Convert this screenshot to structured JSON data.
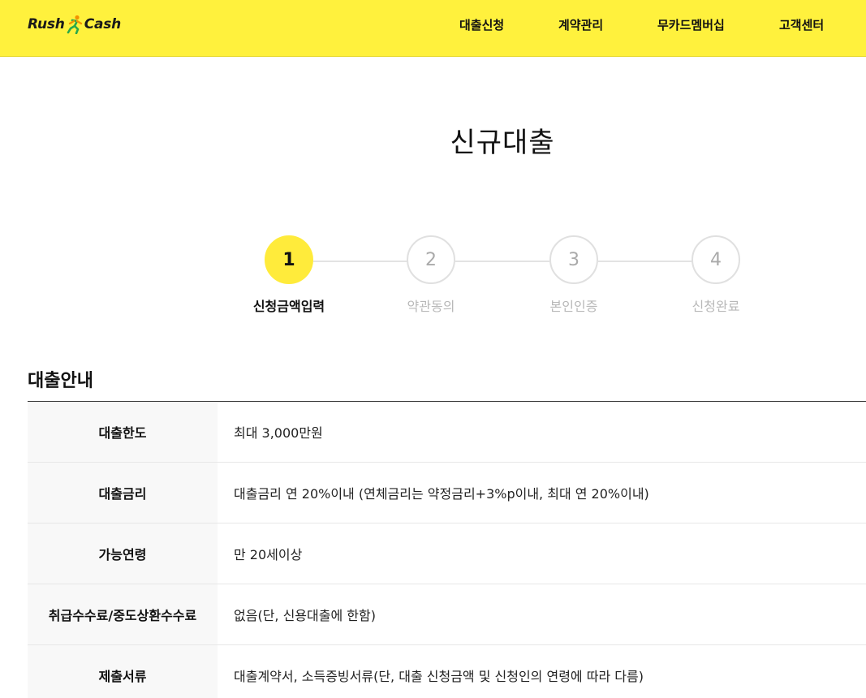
{
  "header": {
    "logo": {
      "left": "Rush",
      "right": "Cash",
      "icon": "runner-icon"
    },
    "nav": [
      {
        "label": "대출신청"
      },
      {
        "label": "계약관리"
      },
      {
        "label": "무카드멤버십"
      },
      {
        "label": "고객센터"
      }
    ],
    "colors": {
      "brand_yellow": "#fff13d",
      "logo_green": "#2aa84a",
      "logo_orange": "#f39200"
    }
  },
  "page": {
    "title": "신규대출"
  },
  "stepper": {
    "steps": [
      {
        "number": "1",
        "label": "신청금액입력",
        "active": true
      },
      {
        "number": "2",
        "label": "약관동의",
        "active": false
      },
      {
        "number": "3",
        "label": "본인인증",
        "active": false
      },
      {
        "number": "4",
        "label": "신청완료",
        "active": false
      }
    ],
    "active_color": "#ffeb3b"
  },
  "section": {
    "title": "대출안내",
    "rows": [
      {
        "head": "대출한도",
        "body": "최대 3,000만원"
      },
      {
        "head": "대출금리",
        "body": "대출금리 연 20%이내 (연체금리는 약정금리+3%p이내, 최대 연 20%이내)"
      },
      {
        "head": "가능연령",
        "body": "만 20세이상"
      },
      {
        "head": "취급수수료/중도상환수수료",
        "body": "없음(단, 신용대출에 한함)"
      },
      {
        "head": "제출서류",
        "body": "대출계약서, 소득증빙서류(단, 대출 신청금액 및 신청인의 연령에 따라 다름)"
      }
    ]
  }
}
